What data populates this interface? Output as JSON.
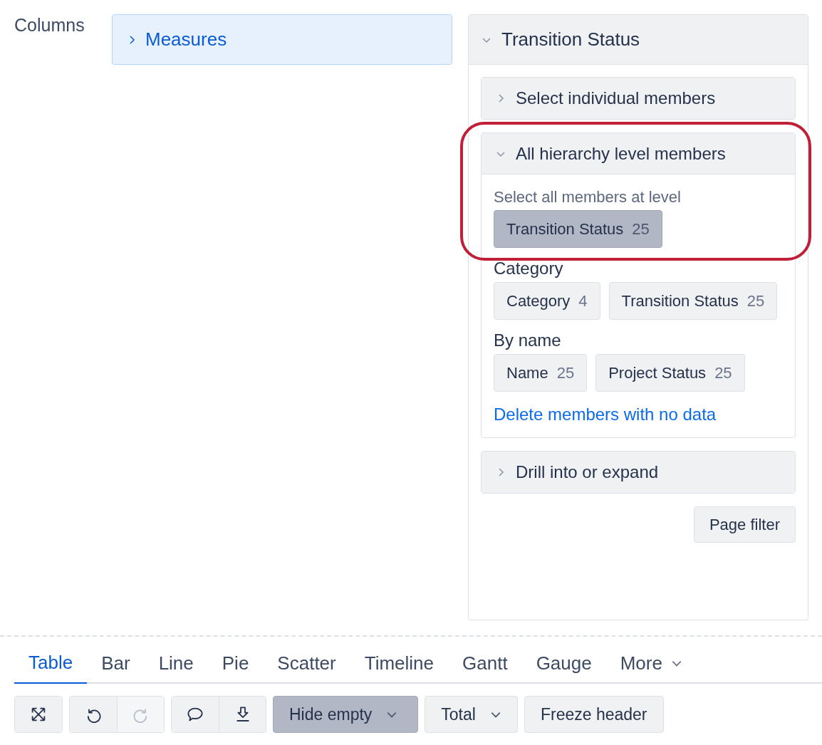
{
  "columns_label": "Columns",
  "columns": [
    {
      "label": "Measures",
      "expanded": false
    }
  ],
  "panel": {
    "title": "Transition Status",
    "expanded": true,
    "sections": [
      {
        "title": "Select individual members",
        "expanded": false,
        "highlighted": false
      },
      {
        "title": "All hierarchy level members",
        "expanded": true,
        "highlighted": true,
        "groups": [
          {
            "kind": "hint",
            "heading": "Select all members at level",
            "chips": [
              {
                "label": "Transition Status",
                "count": "25",
                "selected": true
              }
            ]
          },
          {
            "kind": "heading",
            "heading": "Category",
            "chips": [
              {
                "label": "Category",
                "count": "4",
                "selected": false
              },
              {
                "label": "Transition Status",
                "count": "25",
                "selected": false
              }
            ]
          },
          {
            "kind": "heading",
            "heading": "By name",
            "chips": [
              {
                "label": "Name",
                "count": "25",
                "selected": false
              },
              {
                "label": "Project Status",
                "count": "25",
                "selected": false
              }
            ]
          }
        ],
        "link": "Delete members with no data"
      },
      {
        "title": "Drill into or expand",
        "expanded": false,
        "highlighted": false
      }
    ],
    "button": "Page filter"
  },
  "chart_tabs": [
    {
      "label": "Table",
      "selected": true,
      "kind": "tab"
    },
    {
      "label": "Bar",
      "selected": false,
      "kind": "tab"
    },
    {
      "label": "Line",
      "selected": false,
      "kind": "tab"
    },
    {
      "label": "Pie",
      "selected": false,
      "kind": "tab"
    },
    {
      "label": "Scatter",
      "selected": false,
      "kind": "tab"
    },
    {
      "label": "Timeline",
      "selected": false,
      "kind": "tab"
    },
    {
      "label": "Gantt",
      "selected": false,
      "kind": "tab"
    },
    {
      "label": "Gauge",
      "selected": false,
      "kind": "tab"
    },
    {
      "label": "More",
      "selected": false,
      "kind": "dropdown"
    }
  ],
  "toolbar": [
    {
      "kind": "icons",
      "buttons": [
        {
          "disabled": false
        }
      ]
    },
    {
      "kind": "icons",
      "buttons": [
        {
          "disabled": false
        },
        {
          "disabled": true
        }
      ]
    },
    {
      "kind": "icons",
      "buttons": [
        {
          "disabled": false
        },
        {
          "disabled": false
        }
      ]
    },
    {
      "kind": "dropdown",
      "label": "Hide empty",
      "active": true
    },
    {
      "kind": "dropdown",
      "label": "Total",
      "active": false
    },
    {
      "kind": "button",
      "label": "Freeze header",
      "active": false
    }
  ]
}
